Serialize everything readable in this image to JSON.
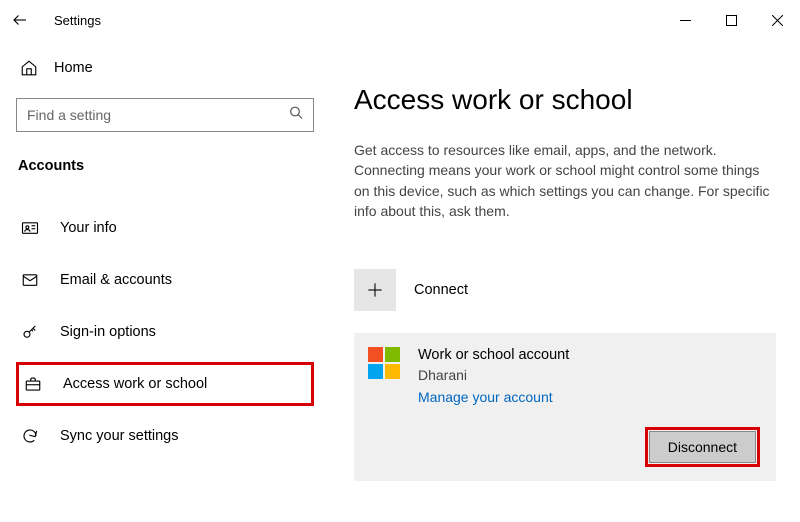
{
  "window": {
    "title": "Settings"
  },
  "sidebar": {
    "home_label": "Home",
    "search_placeholder": "Find a setting",
    "section": "Accounts",
    "items": [
      {
        "label": "Your info"
      },
      {
        "label": "Email & accounts"
      },
      {
        "label": "Sign-in options"
      },
      {
        "label": "Access work or school"
      },
      {
        "label": "Sync your settings"
      }
    ]
  },
  "content": {
    "title": "Access work or school",
    "description": "Get access to resources like email, apps, and the network. Connecting means your work or school might control some things on this device, such as which settings you can change. For specific info about this, ask them.",
    "connect_label": "Connect",
    "account": {
      "title": "Work or school account",
      "subtitle": "Dharani",
      "manage_link": "Manage your account",
      "disconnect": "Disconnect"
    }
  }
}
